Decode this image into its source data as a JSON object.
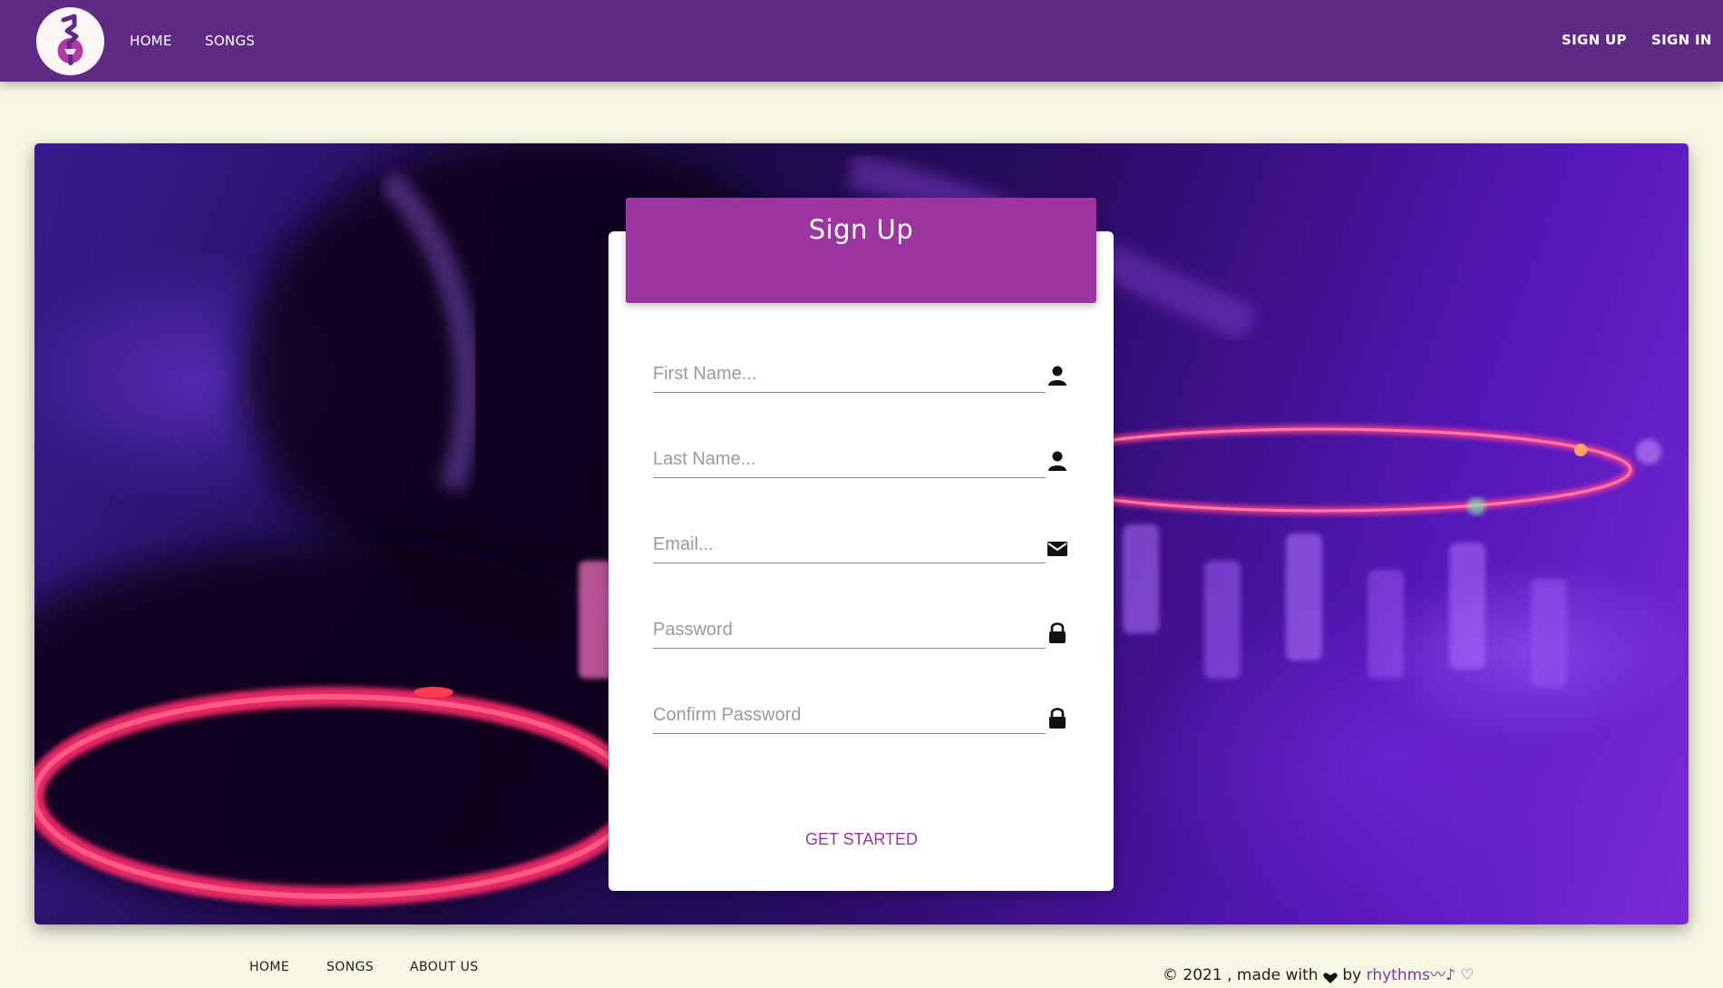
{
  "nav": {
    "home": "HOME",
    "songs": "SONGS",
    "signup": "SIGN UP",
    "signin": "SIGN IN"
  },
  "form": {
    "title": "Sign Up",
    "fields": [
      {
        "placeholder": "First Name...",
        "icon": "user-icon"
      },
      {
        "placeholder": "Last Name...",
        "icon": "user-icon"
      },
      {
        "placeholder": "Email...",
        "icon": "envelope-icon"
      },
      {
        "placeholder": "Password",
        "icon": "lock-icon"
      },
      {
        "placeholder": "Confirm Password",
        "icon": "lock-icon"
      }
    ],
    "submit": "GET STARTED"
  },
  "footer": {
    "links": [
      "HOME",
      "SONGS",
      "ABOUT US"
    ],
    "credit_prefix": "© 2021 , made with",
    "credit_by": "by",
    "brand": "rhythms〰♪ ♡"
  },
  "colors": {
    "navbar": "#5e2a86",
    "accent": "#9b35a0",
    "page_bg": "#f8f7e4"
  }
}
